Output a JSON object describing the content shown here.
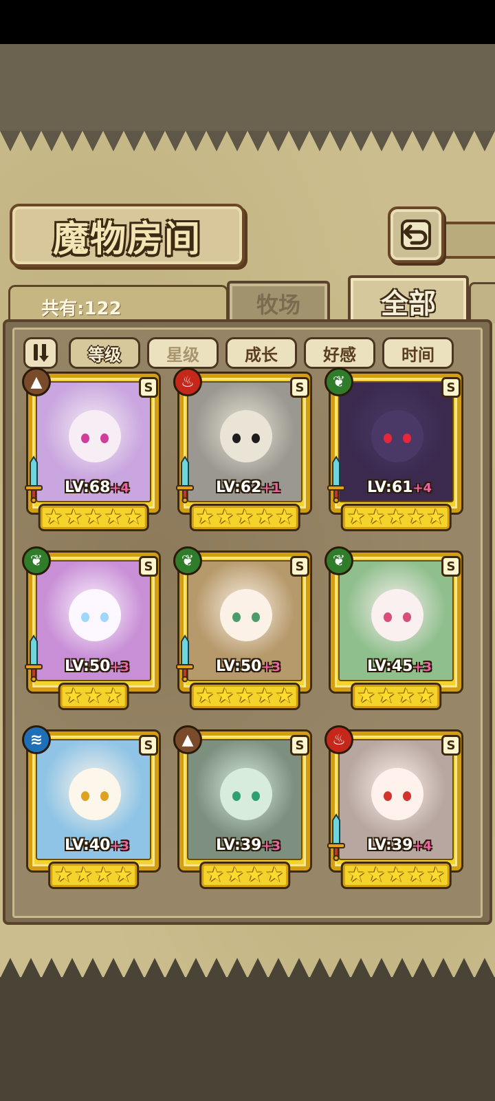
{
  "title": "魔物房间",
  "count_label": "共有:122",
  "tabs": [
    {
      "label": "牧场",
      "active": false
    },
    {
      "label": "全部",
      "active": true
    }
  ],
  "sort_buttons": [
    {
      "label": "等级",
      "active": true
    },
    {
      "label": "星级",
      "active": false
    },
    {
      "label": "成长",
      "active": false
    },
    {
      "label": "好感",
      "active": false
    },
    {
      "label": "时间",
      "active": false
    }
  ],
  "monsters": [
    {
      "level": "LV:68",
      "plus": "+4",
      "stars": 5,
      "element": "earth-icon",
      "element_color": "#7a4b2a",
      "rank": "S",
      "palette": "#c9a6df",
      "face": "#f6eef4",
      "eyes": "#d23d9c",
      "weapon": true
    },
    {
      "level": "LV:62",
      "plus": "+1",
      "stars": 5,
      "element": "fire-icon",
      "element_color": "#c5271b",
      "rank": "S",
      "palette": "#9a9890",
      "face": "#e9e4d6",
      "eyes": "#1d1d1d",
      "weapon": true
    },
    {
      "level": "LV:61",
      "plus": "+4",
      "stars": 5,
      "element": "leaf-icon",
      "element_color": "#2f7d2a",
      "rank": "S",
      "palette": "#3b2a4e",
      "face": "#4a3866",
      "eyes": "#e8263a",
      "weapon": true
    },
    {
      "level": "LV:50",
      "plus": "+3",
      "stars": 3,
      "element": "leaf-icon",
      "element_color": "#2f7d2a",
      "rank": "S",
      "palette": "#c88fd6",
      "face": "#fdf7ff",
      "eyes": "#9fd7ff",
      "weapon": true
    },
    {
      "level": "LV:50",
      "plus": "+3",
      "stars": 5,
      "element": "leaf-icon",
      "element_color": "#2f7d2a",
      "rank": "S",
      "palette": "#b79a6c",
      "face": "#fbf1e6",
      "eyes": "#4b9c6a",
      "weapon": true
    },
    {
      "level": "LV:45",
      "plus": "+3",
      "stars": 4,
      "element": "leaf-icon",
      "element_color": "#2f7d2a",
      "rank": "S",
      "palette": "#8fbf8d",
      "face": "#fbf0f0",
      "eyes": "#d94d7a",
      "weapon": false
    },
    {
      "level": "LV:40",
      "plus": "+3",
      "stars": 4,
      "element": "water-icon",
      "element_color": "#1f6fb8",
      "rank": "S",
      "palette": "#8fc4e6",
      "face": "#fdf6ea",
      "eyes": "#e0a020",
      "weapon": false
    },
    {
      "level": "LV:39",
      "plus": "+3",
      "stars": 4,
      "element": "earth-icon",
      "element_color": "#7a4b2a",
      "rank": "S",
      "palette": "#7d8f7f",
      "face": "#d7ecdc",
      "eyes": "#2ea06f",
      "weapon": false
    },
    {
      "level": "LV:39",
      "plus": "+4",
      "stars": 5,
      "element": "fire-icon",
      "element_color": "#c5271b",
      "rank": "S",
      "palette": "#b7a7a0",
      "face": "#fff2ec",
      "eyes": "#d2332b",
      "weapon": true
    }
  ],
  "icons": {
    "back": "back-arrow-icon",
    "sort_toggle": "sort-order-icon",
    "weapon": "sword-icon"
  }
}
